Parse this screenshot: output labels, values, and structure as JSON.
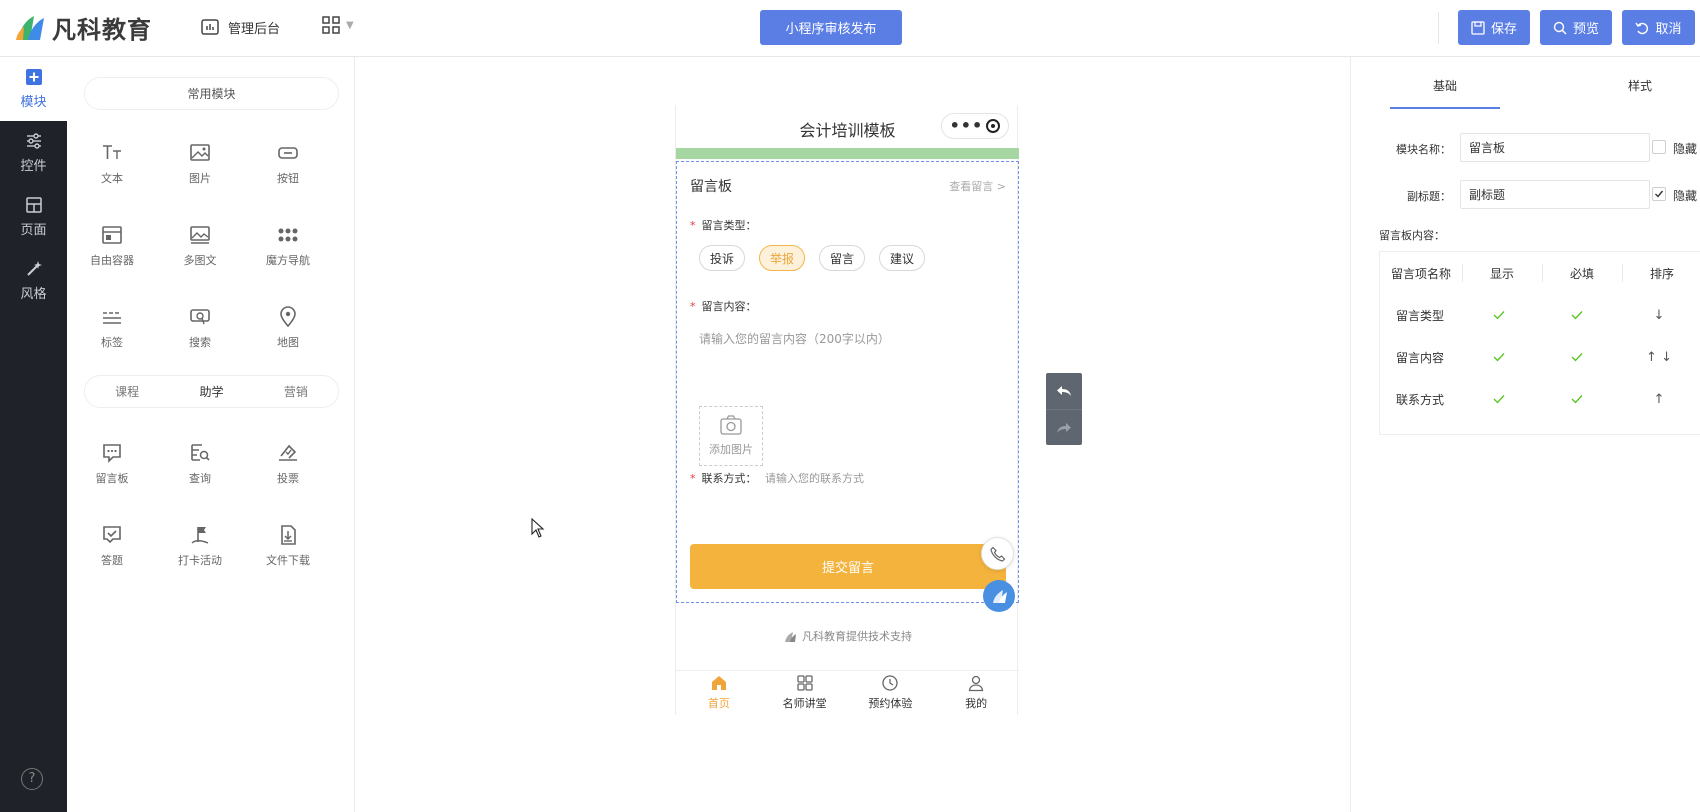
{
  "header": {
    "brand": "凡科教育",
    "admin_label": "管理后台",
    "publish_label": "小程序审核发布",
    "save_label": "保存",
    "preview_label": "预览",
    "cancel_label": "取消"
  },
  "rail": {
    "items": [
      {
        "label": "模块",
        "icon": "plus-square-icon",
        "active": true
      },
      {
        "label": "控件",
        "icon": "sliders-icon"
      },
      {
        "label": "页面",
        "icon": "layout-icon"
      },
      {
        "label": "风格",
        "icon": "magic-wand-icon"
      }
    ],
    "help": "?"
  },
  "modules": {
    "common_title": "常用模块",
    "common": [
      "文本",
      "图片",
      "按钮",
      "自由容器",
      "多图文",
      "魔方导航",
      "标签",
      "搜索",
      "地图"
    ],
    "tabs": [
      "课程",
      "助学",
      "营销"
    ],
    "active_tab": "助学",
    "study": [
      "留言板",
      "查询",
      "投票",
      "答题",
      "打卡活动",
      "文件下载"
    ]
  },
  "phone": {
    "title": "会计培训模板",
    "board_title": "留言板",
    "view_more": "查看留言 >",
    "type_label": "留言类型：",
    "types": [
      "投诉",
      "举报",
      "留言",
      "建议"
    ],
    "selected_type": "举报",
    "content_label": "留言内容：",
    "content_placeholder": "请输入您的留言内容（200字以内）",
    "add_image": "添加图片",
    "contact_label": "联系方式：",
    "contact_placeholder": "请输入您的联系方式",
    "submit": "提交留言",
    "support": "凡科教育提供技术支持",
    "tabs": [
      "首页",
      "名师讲堂",
      "预约体验",
      "我的"
    ],
    "active_tab": "首页"
  },
  "settings": {
    "tab_basic": "基础",
    "tab_style": "样式",
    "name_label": "模块名称：",
    "name_value": "留言板",
    "subtitle_label": "副标题：",
    "subtitle_value": "副标题",
    "hide_label": "隐藏",
    "name_hidden": false,
    "subtitle_hidden": true,
    "content_label": "留言板内容：",
    "table_headers": [
      "留言项名称",
      "显示",
      "必填",
      "排序"
    ],
    "rows": [
      {
        "name": "留言类型",
        "show": true,
        "required": true,
        "sort": "↓"
      },
      {
        "name": "留言内容",
        "show": true,
        "required": true,
        "sort": "↑ ↓"
      },
      {
        "name": "联系方式",
        "show": true,
        "required": true,
        "sort": "↑"
      }
    ]
  },
  "colors": {
    "primary": "#5b7ee5",
    "rail_bg": "#1f2228",
    "accent_orange": "#f4b33d",
    "check_green": "#52c41a"
  }
}
